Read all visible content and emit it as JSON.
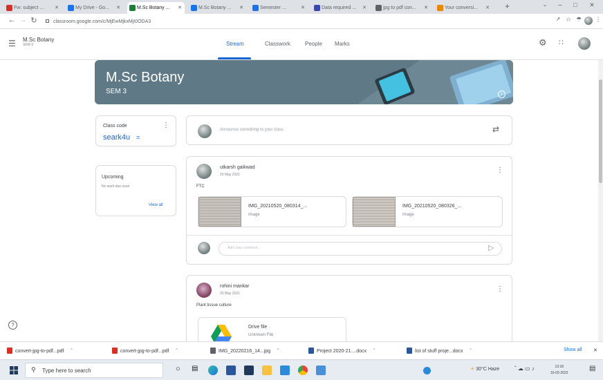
{
  "browser": {
    "tabs": [
      {
        "label": "Fw: subject ...",
        "color": "#d93025"
      },
      {
        "label": "My Drive - Go...",
        "color": "#1a73e8"
      },
      {
        "label": "M.Sc Botany ...",
        "color": "#188038",
        "active": true
      },
      {
        "label": "M.Sc Botany ...",
        "color": "#1a73e8"
      },
      {
        "label": "Semester ...",
        "color": "#1a73e8"
      },
      {
        "label": "Data required ...",
        "color": "#3949ab"
      },
      {
        "label": "jpg to pdf con...",
        "color": "#5f6368"
      },
      {
        "label": "Your conversi...",
        "color": "#ea8600"
      }
    ],
    "url": "classroom.google.com/c/MjEwMjkxMjI0ODA3"
  },
  "app": {
    "class_name": "M.Sc Botany",
    "section": "SEM 3",
    "nav_tabs": [
      "Stream",
      "Classwork",
      "People",
      "Marks"
    ]
  },
  "banner": {
    "title": "M.Sc Botany",
    "subtitle": "SEM 3"
  },
  "class_code": {
    "label": "Class code",
    "code": "seark4u"
  },
  "upcoming": {
    "title": "Upcoming",
    "message": "No work due soon",
    "link": "View all"
  },
  "announce": {
    "placeholder": "Announce something to your class"
  },
  "posts": [
    {
      "author": "utkarsh gaikwad",
      "date": "20 May 2021",
      "body": "FTC",
      "attachments": [
        {
          "name": "IMG_20210520_080314_...",
          "type": "Image"
        },
        {
          "name": "IMG_20210520_080326_...",
          "type": "Image"
        }
      ],
      "comment_placeholder": "Add class comment..."
    },
    {
      "author": "rohini mankar",
      "date": "20 May 2021",
      "body": "Plant tissue culture",
      "attachments": [
        {
          "name": "Drive file",
          "type": "Unknown File"
        }
      ]
    }
  ],
  "downloads": {
    "items": [
      "convert-jpg-to-pdf...pdf",
      "convert-jpg-to-pdf...pdf",
      "IMG_20220216_14...jpg",
      "Project 2020-21....docx",
      "list of stuff proje...docx"
    ],
    "show_all": "Show all"
  },
  "taskbar": {
    "search_placeholder": "Type here to search",
    "weather": "30°C Haze",
    "time": "13:18",
    "date": "16-02-2022"
  },
  "colors": {
    "accent": "#1967d2",
    "banner": "#5f7a86"
  }
}
